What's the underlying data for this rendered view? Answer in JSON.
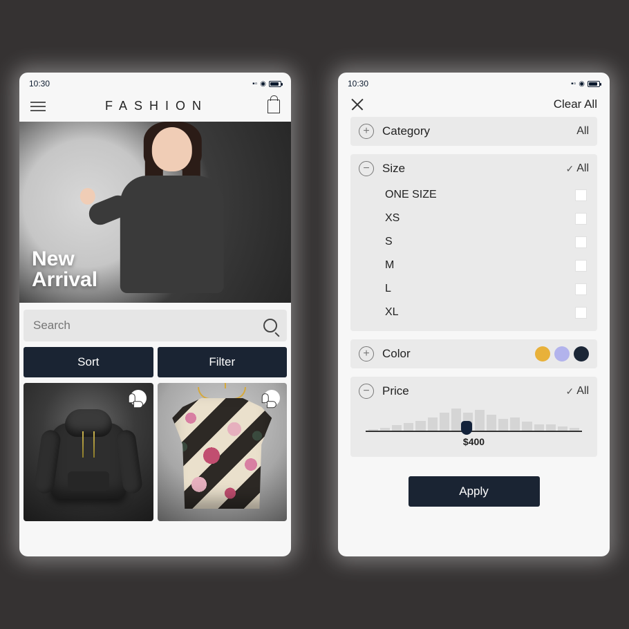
{
  "status": {
    "time": "10:30"
  },
  "screen1": {
    "brand": "FASHION",
    "hero": {
      "line1": "New",
      "line2": "Arrival"
    },
    "search": {
      "placeholder": "Search"
    },
    "buttons": {
      "sort": "Sort",
      "filter": "Filter"
    }
  },
  "screen2": {
    "clear_all": "Clear All",
    "category": {
      "label": "Category",
      "value": "All"
    },
    "size": {
      "label": "Size",
      "value": "All",
      "options": [
        "ONE SIZE",
        "XS",
        "S",
        "M",
        "L",
        "XL"
      ]
    },
    "color": {
      "label": "Color",
      "swatches": [
        "#e8b13a",
        "#b2b3ec",
        "#1b2636"
      ]
    },
    "price": {
      "label": "Price",
      "value_all": "All",
      "current_label": "$400",
      "bars": [
        4,
        6,
        9,
        12,
        15,
        20,
        26,
        32,
        26,
        30,
        24,
        18,
        20,
        14,
        10,
        10,
        8,
        6
      ]
    },
    "apply": "Apply"
  }
}
